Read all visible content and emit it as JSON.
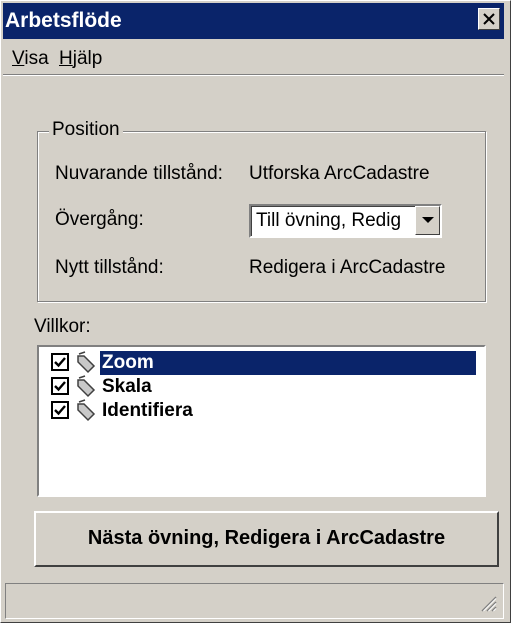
{
  "window": {
    "title": "Arbetsflöde"
  },
  "menu": [
    {
      "mnemonic": "V",
      "rest": "isa"
    },
    {
      "mnemonic": "H",
      "rest": "jälp"
    }
  ],
  "position_group": {
    "legend": "Position",
    "current_state_label": "Nuvarande tillstånd:",
    "current_state_value": "Utforska ArcCadastre",
    "transition_label": "Övergång:",
    "transition_value": "Till övning, Redig",
    "new_state_label": "Nytt tillstånd:",
    "new_state_value": "Redigera i ArcCadastre"
  },
  "conditions": {
    "label": "Villkor:",
    "items": [
      {
        "label": "Zoom",
        "checked": true,
        "selected": true
      },
      {
        "label": "Skala",
        "checked": true,
        "selected": false
      },
      {
        "label": "Identifiera",
        "checked": true,
        "selected": false
      }
    ]
  },
  "next_button": {
    "label": "Nästa övning, Redigera i ArcCadastre"
  },
  "icons": {
    "close": "close-icon",
    "dropdown": "chevron-down-icon",
    "condition": "tag-icon",
    "grip": "resize-grip-icon"
  },
  "colors": {
    "titlebar": "#0a246a",
    "face": "#d4d0c8",
    "selection": "#0a246a"
  }
}
